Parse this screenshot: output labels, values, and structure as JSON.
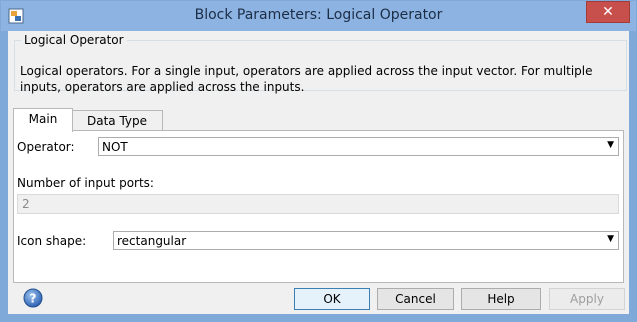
{
  "window": {
    "title": "Block Parameters: Logical Operator",
    "close_glyph": "✕"
  },
  "group": {
    "legend": "Logical Operator",
    "description": "Logical operators.  For a single input, operators are applied across the input vector.  For multiple inputs, operators are applied across the inputs."
  },
  "tabs": [
    {
      "label": "Main",
      "active": true
    },
    {
      "label": "Data Type",
      "active": false
    }
  ],
  "main": {
    "operator_label": "Operator:",
    "operator_value": "NOT",
    "num_ports_label": "Number of input ports:",
    "num_ports_value": "2",
    "icon_shape_label": "Icon shape:",
    "icon_shape_value": "rectangular"
  },
  "buttons": {
    "ok": "OK",
    "cancel": "Cancel",
    "help": "Help",
    "apply": "Apply"
  },
  "icons": {
    "app": "block-app-icon",
    "help": "help-question-icon",
    "dropdown": "chevron-down-icon"
  },
  "colors": {
    "titlebar": "#8db3e2",
    "close": "#c7504c",
    "client": "#f0f0f0",
    "default_button_border": "#3c7fb1"
  }
}
